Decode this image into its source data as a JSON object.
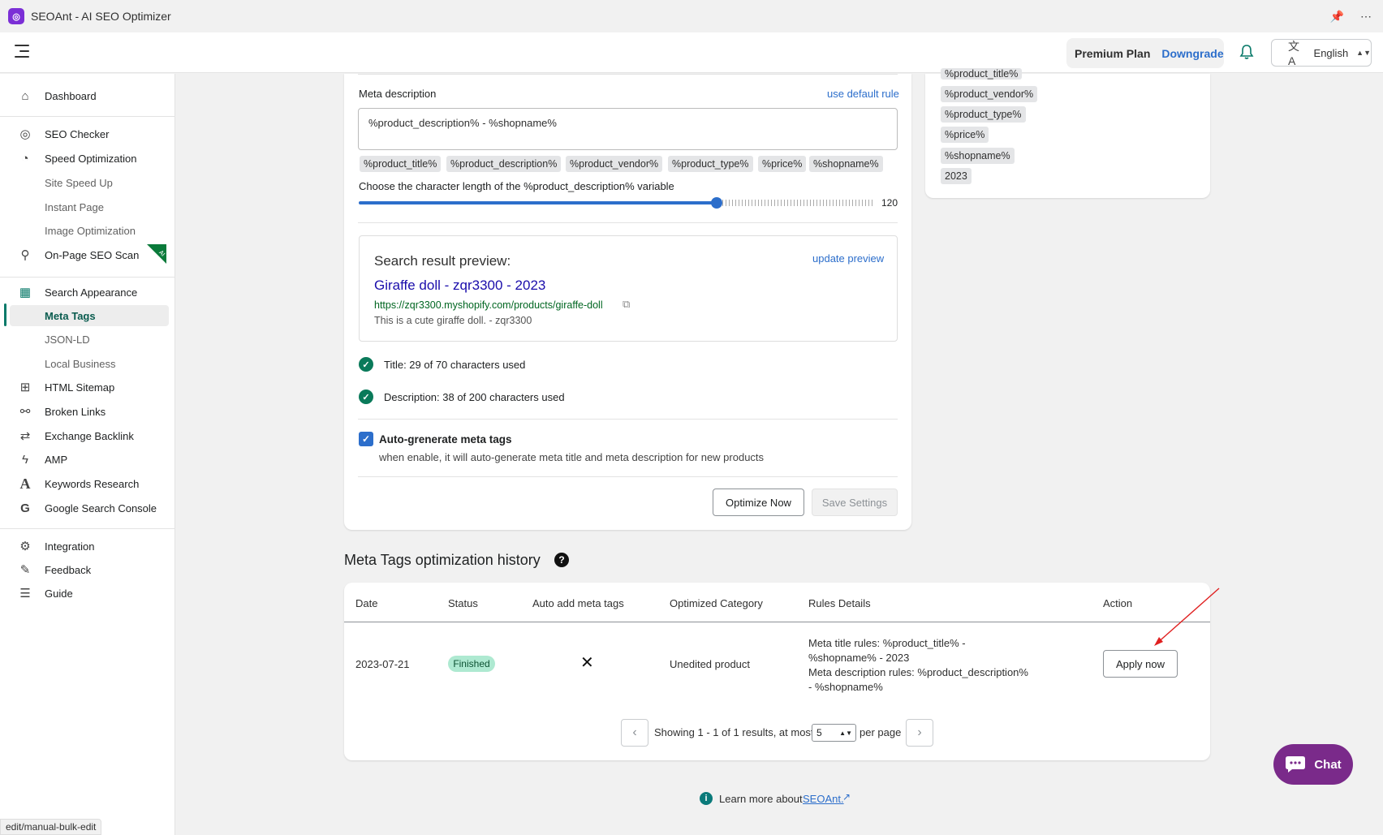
{
  "window": {
    "title": "SEOAnt - AI SEO Optimizer",
    "pin_icon": "pin-icon",
    "more_icon": "more-icon"
  },
  "header": {
    "plan": "Premium Plan",
    "downgrade": "Downgrade",
    "language": "English"
  },
  "sidebar": {
    "dashboard": "Dashboard",
    "seo_checker": "SEO Checker",
    "speed_optimization": "Speed Optimization",
    "site_speed_up": "Site Speed Up",
    "instant_page": "Instant Page",
    "image_optimization": "Image Optimization",
    "on_page_seo_scan": "On-Page SEO Scan",
    "ai_badge": "AI",
    "search_appearance": "Search Appearance",
    "meta_tags": "Meta Tags",
    "json_ld": "JSON-LD",
    "local_business": "Local Business",
    "html_sitemap": "HTML Sitemap",
    "broken_links": "Broken Links",
    "exchange_backlink": "Exchange Backlink",
    "amp": "AMP",
    "keywords_research": "Keywords Research",
    "google_search_console": "Google Search Console",
    "integration": "Integration",
    "feedback": "Feedback",
    "guide": "Guide"
  },
  "meta_form": {
    "meta_description_label": "Meta description",
    "use_default_rule": "use default rule",
    "meta_description_value": "%product_description% - %shopname%",
    "variables": [
      "%product_title%",
      "%product_description%",
      "%product_vendor%",
      "%product_type%",
      "%price%",
      "%shopname%"
    ],
    "slider_label": "Choose the character length of the %product_description% variable",
    "slider_value": "120",
    "slider_fraction": 0.69,
    "preview_heading": "Search result preview:",
    "update_preview": "update preview",
    "preview_title": "Giraffe doll - zqr3300 - 2023",
    "preview_url": "https://zqr3300.myshopify.com/products/giraffe-doll",
    "preview_desc": "This is a cute giraffe doll. - zqr3300",
    "title_count": "Title: 29 of 70 characters used",
    "desc_count": "Description: 38 of 200 characters used",
    "auto_generate_label": "Auto-grenerate meta tags",
    "auto_generate_help": "when enable, it will auto-generate meta title and meta description for new products",
    "optimize_now": "Optimize Now",
    "save_settings": "Save Settings"
  },
  "variable_panel": [
    "%product_title%",
    "%product_vendor%",
    "%product_type%",
    "%price%",
    "%shopname%",
    "2023"
  ],
  "history": {
    "heading": "Meta Tags optimization history",
    "help_icon": "?",
    "columns": [
      "Date",
      "Status",
      "Auto add meta tags",
      "Optimized Category",
      "Rules Details",
      "Action"
    ],
    "rows": [
      {
        "date": "2023-07-21",
        "status": "Finished",
        "auto_add": "✕",
        "category": "Unedited product",
        "rules_1": "Meta title rules: %product_title% -",
        "rules_2": "%shopname% - 2023",
        "rules_3": "Meta description rules: %product_description%",
        "rules_4": "- %shopname%",
        "action": "Apply now"
      }
    ],
    "pager_text": "Showing 1 - 1 of 1 results, at most",
    "per_page_value": "5",
    "per_page_label": "per page"
  },
  "footer": {
    "learn_more": "Learn more about",
    "seoant_link": "SEOAnt."
  },
  "chat": {
    "label": "Chat"
  },
  "statusbar": {
    "url": "edit/manual-bulk-edit"
  },
  "colors": {
    "accent": "#2c6ecb",
    "brand": "#7b2fd6",
    "success": "#0a7a5a",
    "chat": "#7a2a8a"
  }
}
